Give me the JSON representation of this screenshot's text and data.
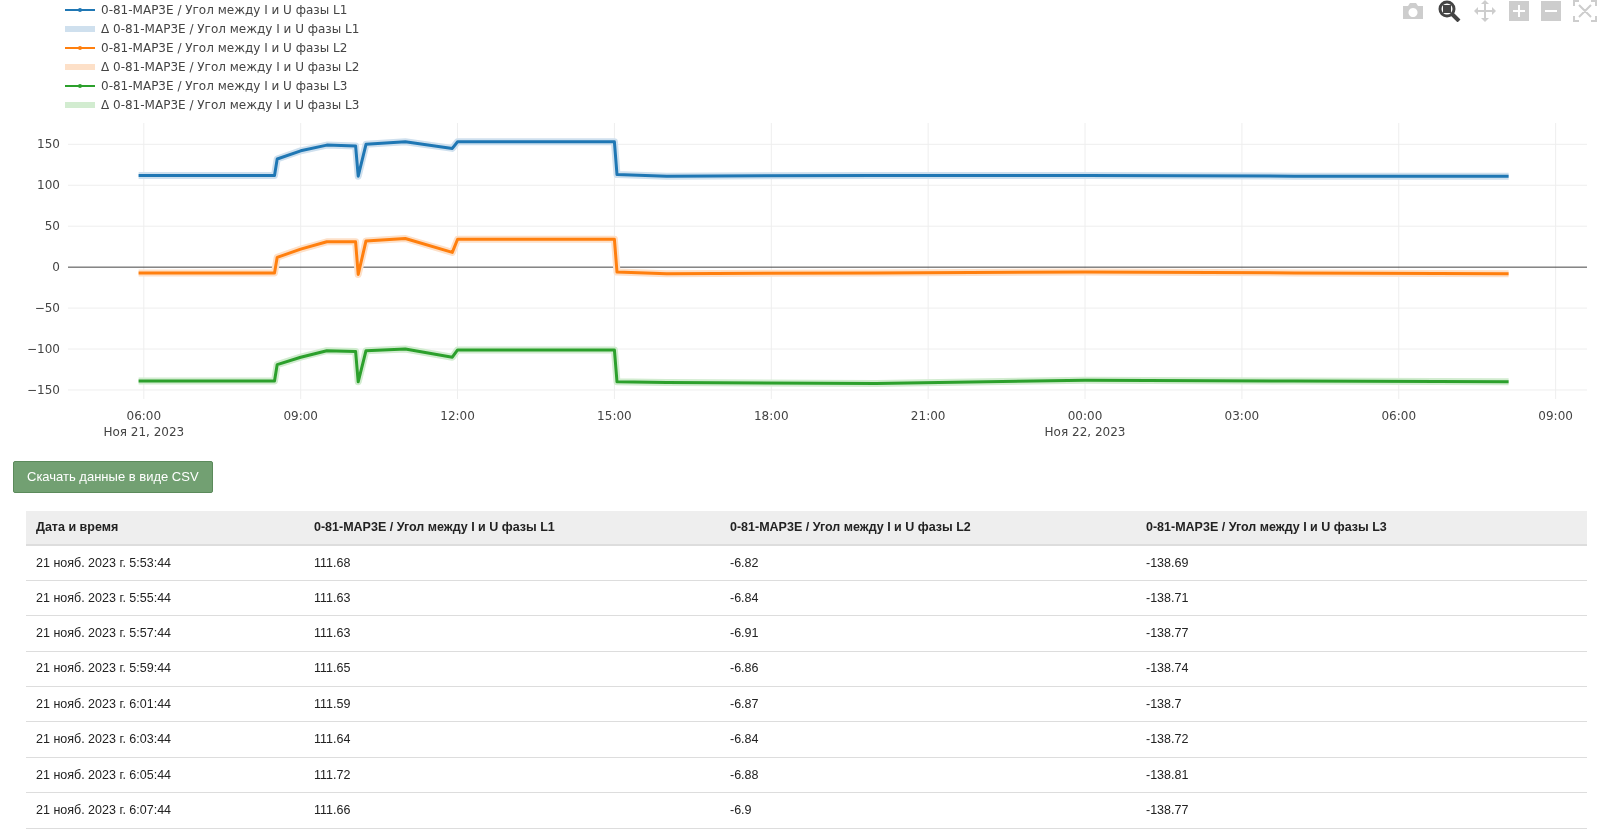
{
  "modebar": [
    {
      "kind": "camera",
      "selected": false
    },
    {
      "kind": "zoom",
      "selected": true
    },
    {
      "kind": "pan",
      "selected": false
    },
    {
      "kind": "zoom-in",
      "selected": false
    },
    {
      "kind": "zoom-out",
      "selected": false
    },
    {
      "kind": "autoscale",
      "selected": false
    }
  ],
  "chart_data": {
    "type": "line",
    "grid": true,
    "legend": true,
    "x": [
      "2023-11-21T05:54",
      "2023-11-21T08:30",
      "2023-11-21T08:33",
      "2023-11-21T09:00",
      "2023-11-21T09:30",
      "2023-11-21T10:03",
      "2023-11-21T10:06",
      "2023-11-21T10:15",
      "2023-11-21T11:00",
      "2023-11-21T11:54",
      "2023-11-21T12:00",
      "2023-11-21T15:00",
      "2023-11-21T15:03",
      "2023-11-21T16:00",
      "2023-11-21T20:00",
      "2023-11-22T00:00",
      "2023-11-22T04:00",
      "2023-11-22T08:06"
    ],
    "xlim": [
      "2023-11-21T04:33",
      "2023-11-22T09:36"
    ],
    "ylim": [
      -161,
      176
    ],
    "xticks": [
      {
        "value": "2023-11-21T06:00",
        "label": "06:00\nНоя 21, 2023"
      },
      {
        "value": "2023-11-21T09:00",
        "label": "09:00"
      },
      {
        "value": "2023-11-21T12:00",
        "label": "12:00"
      },
      {
        "value": "2023-11-21T15:00",
        "label": "15:00"
      },
      {
        "value": "2023-11-21T18:00",
        "label": "18:00"
      },
      {
        "value": "2023-11-21T21:00",
        "label": "21:00"
      },
      {
        "value": "2023-11-22T00:00",
        "label": "00:00\nНоя 22, 2023"
      },
      {
        "value": "2023-11-22T03:00",
        "label": "03:00"
      },
      {
        "value": "2023-11-22T06:00",
        "label": "06:00"
      },
      {
        "value": "2023-11-22T09:00",
        "label": "09:00"
      }
    ],
    "yticks": [
      {
        "value": -150,
        "label": "−150"
      },
      {
        "value": -100,
        "label": "−100"
      },
      {
        "value": -50,
        "label": "−50"
      },
      0,
      50,
      100,
      150
    ],
    "series": [
      {
        "name": "0-81-MAP3E / Угол между I и U фазы L1",
        "color": "#1f77b4",
        "values": [
          112,
          112,
          132,
          142,
          149,
          148,
          111,
          150,
          153,
          145,
          153,
          153,
          113,
          111,
          112,
          112,
          111,
          111
        ]
      },
      {
        "name": "Δ 0-81-MAP3E / Угол между I и U фазы L1",
        "color": "#cfe0ee",
        "values": [
          112,
          112,
          132,
          142,
          149,
          148,
          111,
          150,
          153,
          145,
          153,
          153,
          113,
          111,
          112,
          112,
          111,
          111
        ]
      },
      {
        "name": "0-81-MAP3E / Угол между I и U фазы L2",
        "color": "#ff7f0e",
        "values": [
          -7,
          -7,
          12,
          22,
          31,
          31,
          -9,
          32,
          35,
          18,
          34,
          34,
          -6,
          -8,
          -7,
          -6,
          -7,
          -8
        ]
      },
      {
        "name": "Δ 0-81-MAP3E / Угол между I и U фазы L2",
        "color": "#fde0c8",
        "values": [
          -7,
          -7,
          12,
          22,
          31,
          31,
          -9,
          32,
          35,
          18,
          34,
          34,
          -6,
          -8,
          -7,
          -6,
          -7,
          -8
        ]
      },
      {
        "name": "0-81-MAP3E / Угол между I и U фазы L3",
        "color": "#2ca02c",
        "values": [
          -139,
          -139,
          -119,
          -110,
          -102,
          -103,
          -140,
          -102,
          -100,
          -110,
          -101,
          -101,
          -140,
          -141,
          -142,
          -138,
          -139,
          -140
        ]
      },
      {
        "name": "Δ 0-81-MAP3E / Угол между I и U фазы L3",
        "color": "#d2ecd0",
        "values": [
          -139,
          -139,
          -119,
          -110,
          -102,
          -103,
          -140,
          -102,
          -100,
          -110,
          -101,
          -101,
          -140,
          -141,
          -142,
          -138,
          -139,
          -140
        ]
      }
    ]
  },
  "download_button": "Скачать данные в виде CSV",
  "table": {
    "columns": [
      "Дата и время",
      "0-81-MAP3E / Угол между I и U фазы L1",
      "0-81-MAP3E / Угол между I и U фазы L2",
      "0-81-MAP3E / Угол между I и U фазы L3"
    ],
    "rows": [
      [
        "21 нояб. 2023 г. 5:53:44",
        "111.68",
        "-6.82",
        "-138.69"
      ],
      [
        "21 нояб. 2023 г. 5:55:44",
        "111.63",
        "-6.84",
        "-138.71"
      ],
      [
        "21 нояб. 2023 г. 5:57:44",
        "111.63",
        "-6.91",
        "-138.77"
      ],
      [
        "21 нояб. 2023 г. 5:59:44",
        "111.65",
        "-6.86",
        "-138.74"
      ],
      [
        "21 нояб. 2023 г. 6:01:44",
        "111.59",
        "-6.87",
        "-138.7"
      ],
      [
        "21 нояб. 2023 г. 6:03:44",
        "111.64",
        "-6.84",
        "-138.72"
      ],
      [
        "21 нояб. 2023 г. 6:05:44",
        "111.72",
        "-6.88",
        "-138.81"
      ],
      [
        "21 нояб. 2023 г. 6:07:44",
        "111.66",
        "-6.9",
        "-138.77"
      ]
    ]
  }
}
